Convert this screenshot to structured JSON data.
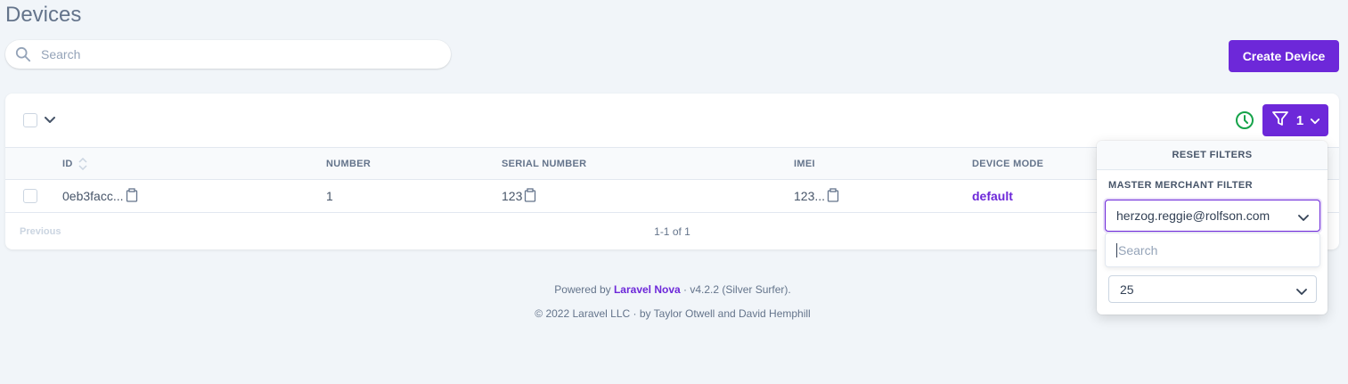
{
  "page": {
    "title": "Devices"
  },
  "search": {
    "placeholder": "Search"
  },
  "actions": {
    "create_label": "Create Device"
  },
  "filter": {
    "active_count": "1"
  },
  "table": {
    "headers": [
      "ID",
      "NUMBER",
      "SERIAL NUMBER",
      "IMEI",
      "DEVICE MODE"
    ],
    "rows": [
      {
        "id": "0eb3facc...",
        "number": "1",
        "serial_number": "123",
        "imei": "123...",
        "device_mode": "default"
      }
    ]
  },
  "pagination": {
    "previous_label": "Previous",
    "count": "1-1 of 1"
  },
  "footer": {
    "powered_prefix": "Powered by ",
    "powered_brand": "Laravel Nova",
    "powered_suffix": " · v4.2.2 (Silver Surfer).",
    "copyright": "© 2022 Laravel LLC · by Taylor Otwell and David Hemphill"
  },
  "filter_dropdown": {
    "reset_label": "RESET FILTERS",
    "filter_label": "MASTER MERCHANT FILTER",
    "selected_value": "herzog.reggie@rolfson.com",
    "search_placeholder": "Search",
    "per_page_value": "25"
  },
  "colors": {
    "accent": "#6d28d9",
    "status_green": "#16a34a",
    "background": "#f1f5f9"
  },
  "icons": [
    "search-icon",
    "chevron-down-icon",
    "clock-icon",
    "filter-icon",
    "sort-icon",
    "copy-icon"
  ]
}
